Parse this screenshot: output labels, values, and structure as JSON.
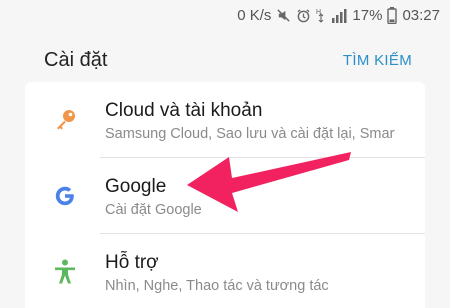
{
  "status_bar": {
    "speed": "0 K/s",
    "battery": "17%",
    "time": "03:27",
    "icons": [
      "mute-icon",
      "alarm-icon",
      "network-icon",
      "signal-icon",
      "battery-icon"
    ]
  },
  "header": {
    "title": "Cài đặt",
    "search_label": "TÌM KIẾM"
  },
  "settings_items": [
    {
      "title": "Cloud và tài khoản",
      "subtitle": "Samsung Cloud, Sao lưu và cài đặt lại, Smart...",
      "icon": "key-icon",
      "icon_color": "#f0954a"
    },
    {
      "title": "Google",
      "subtitle": "Cài đặt Google",
      "icon": "google-icon",
      "icon_color": "#4a82e8"
    },
    {
      "title": "Hỗ trợ",
      "subtitle": "Nhìn, Nghe, Thao tác và tương tác",
      "icon": "accessibility-icon",
      "icon_color": "#5cb85c"
    }
  ],
  "colors": {
    "accent": "#2b8fc8",
    "annotation_arrow": "#f2215f",
    "background": "#f6f6f6"
  }
}
